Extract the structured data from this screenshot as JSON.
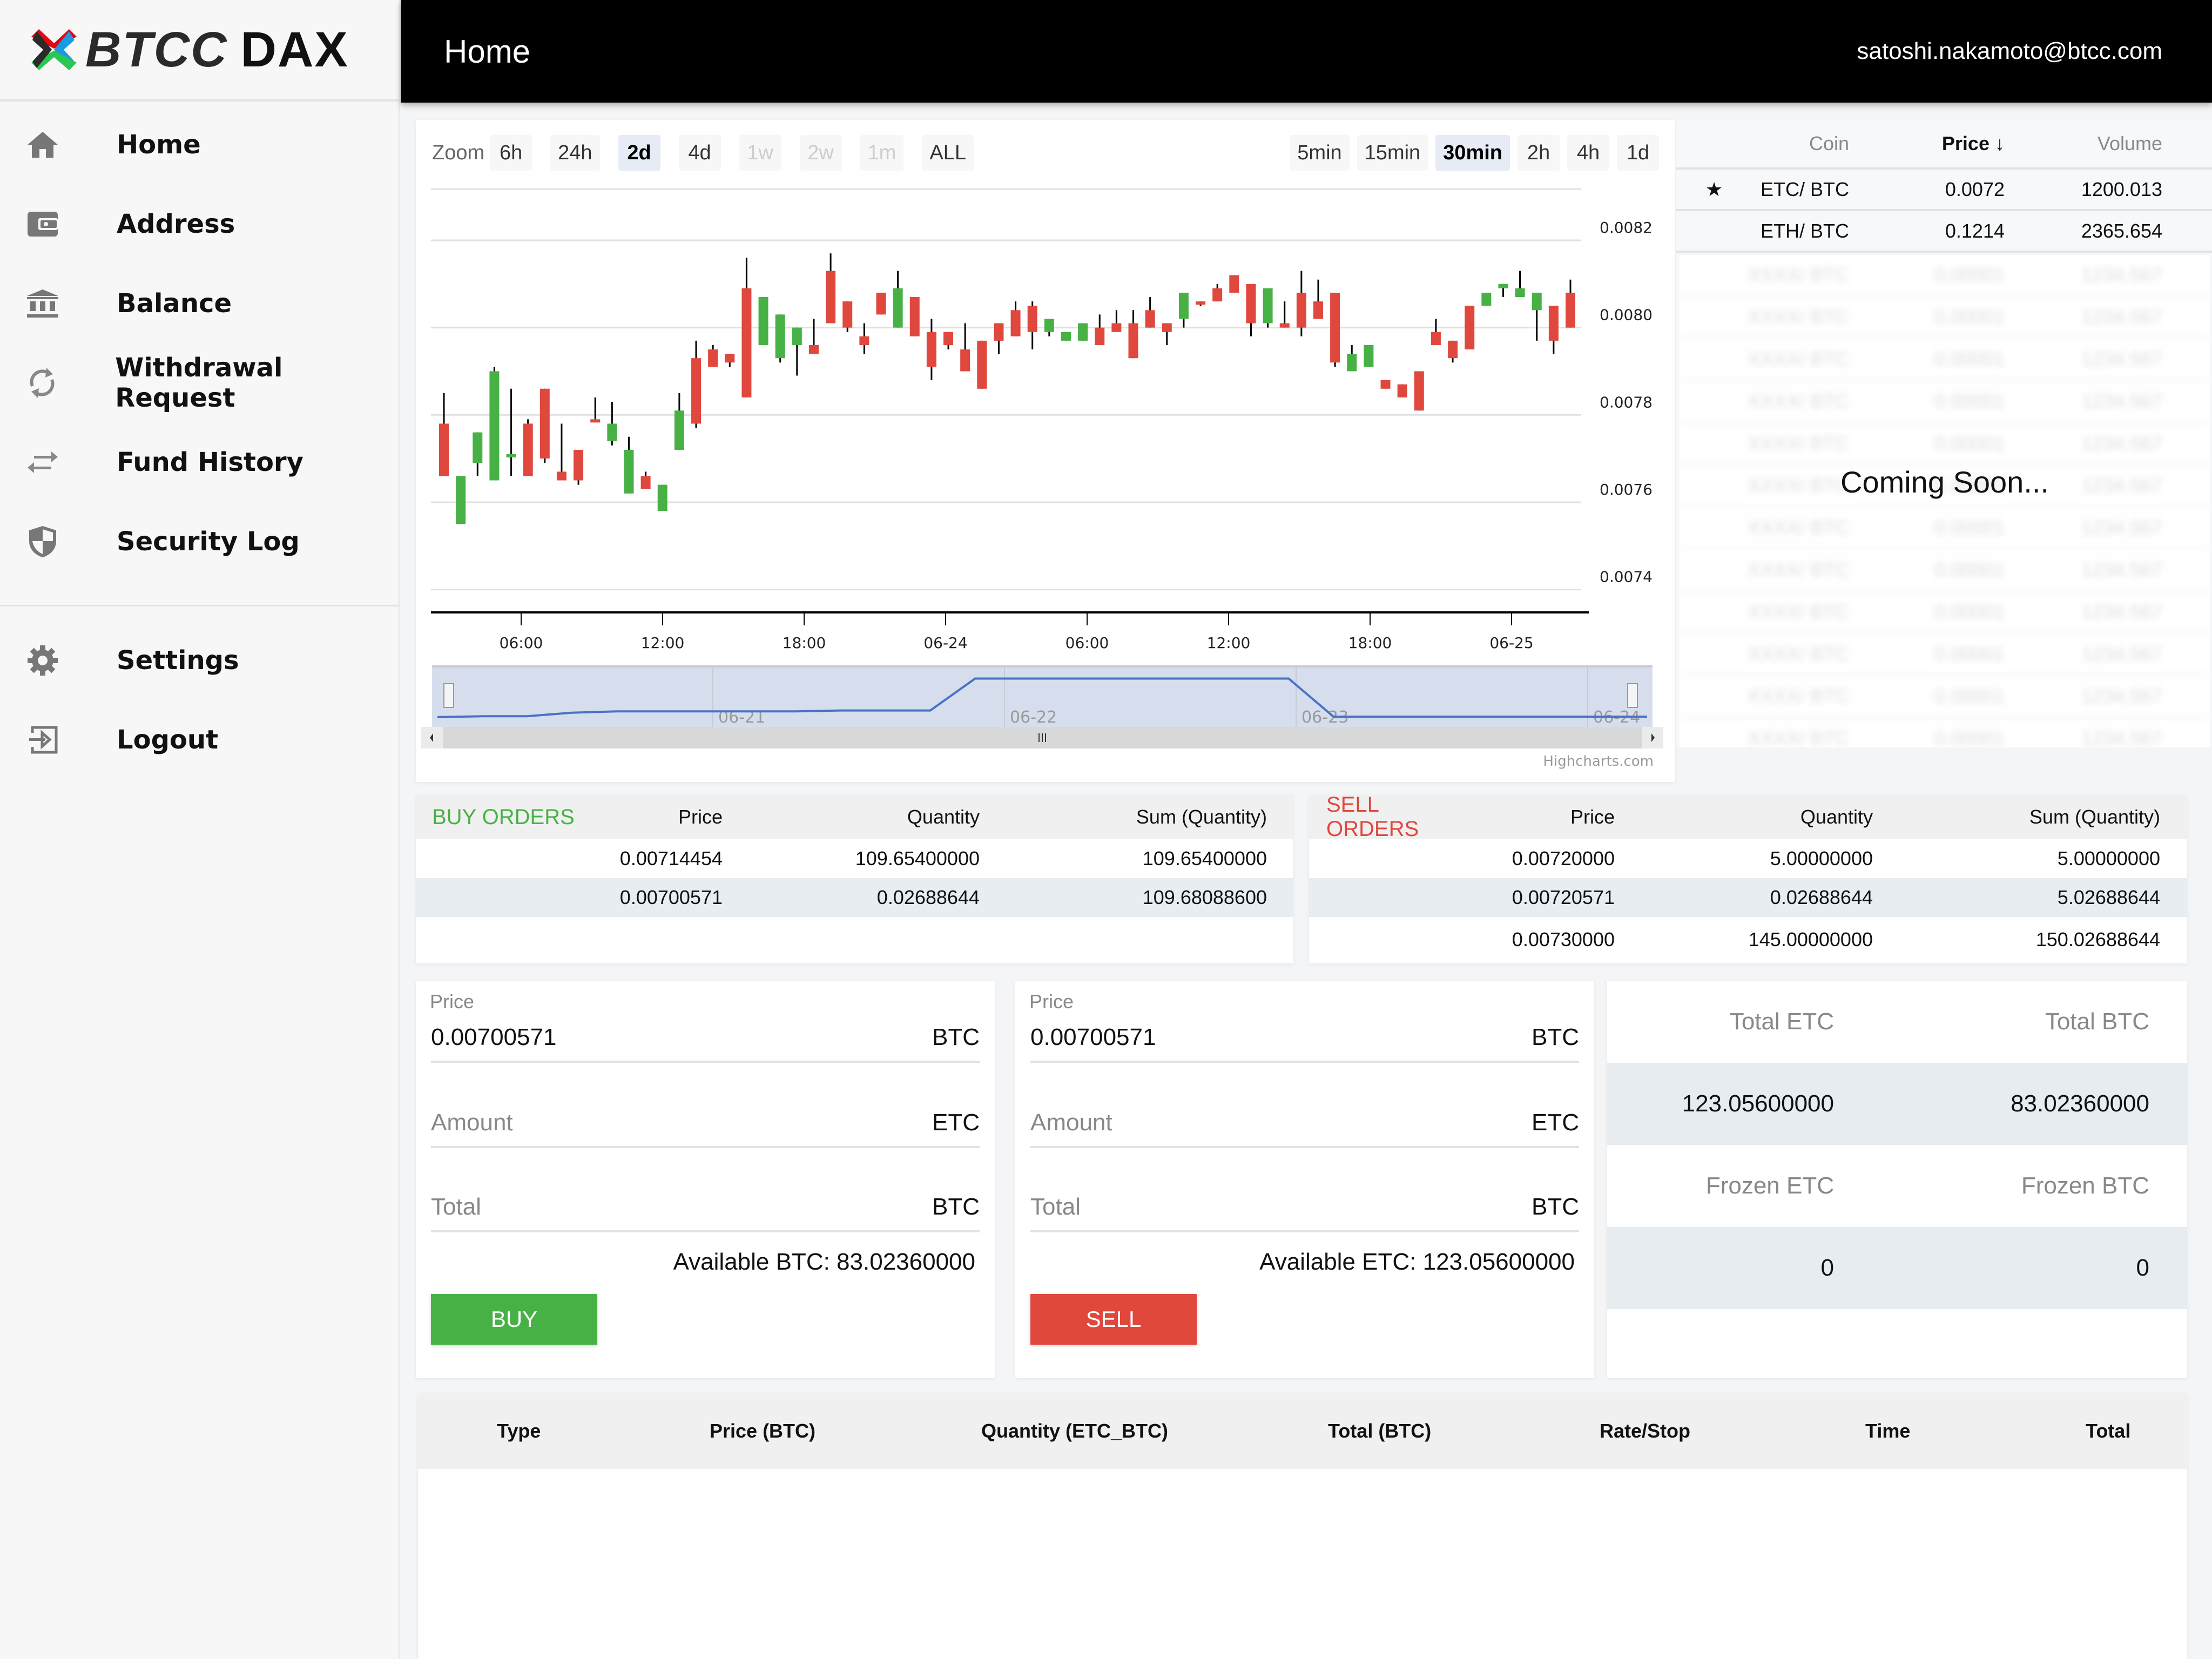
{
  "brand": {
    "name": "BTCC",
    "suffix": "DAX",
    "colors": {
      "red": "#e30613",
      "blue": "#1a9ae0",
      "green": "#2bc754",
      "dark": "#2c2a29"
    }
  },
  "header": {
    "title": "Home",
    "user_email": "satoshi.nakamoto@btcc.com"
  },
  "sidebar": {
    "items": [
      {
        "label": "Home",
        "icon": "home-icon"
      },
      {
        "label": "Address",
        "icon": "wallet-icon"
      },
      {
        "label": "Balance",
        "icon": "bank-icon"
      },
      {
        "label": "Withdrawal Request",
        "icon": "sync-icon"
      },
      {
        "label": "Fund History",
        "icon": "swap-arrows-icon"
      },
      {
        "label": "Security Log",
        "icon": "shield-icon"
      }
    ],
    "secondary": [
      {
        "label": "Settings",
        "icon": "gear-icon"
      },
      {
        "label": "Logout",
        "icon": "logout-icon"
      }
    ]
  },
  "chart_controls": {
    "zoom_label": "Zoom",
    "ranges": [
      {
        "label": "6h",
        "state": "enabled"
      },
      {
        "label": "24h",
        "state": "enabled"
      },
      {
        "label": "2d",
        "state": "selected"
      },
      {
        "label": "4d",
        "state": "enabled"
      },
      {
        "label": "1w",
        "state": "disabled"
      },
      {
        "label": "2w",
        "state": "disabled"
      },
      {
        "label": "1m",
        "state": "disabled"
      },
      {
        "label": "ALL",
        "state": "enabled"
      }
    ],
    "intervals": [
      {
        "label": "5min",
        "state": "enabled"
      },
      {
        "label": "15min",
        "state": "enabled"
      },
      {
        "label": "30min",
        "state": "selected"
      },
      {
        "label": "2h",
        "state": "enabled"
      },
      {
        "label": "4h",
        "state": "enabled"
      },
      {
        "label": "1d",
        "state": "enabled"
      }
    ],
    "credits": "Highcharts.com"
  },
  "chart_data": {
    "type": "candlestick",
    "title": "",
    "xlabel": "",
    "ylabel": "",
    "ylim": [
      0.00735,
      0.00832
    ],
    "y_ticks": [
      "0.0082",
      "0.0080",
      "0.0078",
      "0.0076",
      "0.0074"
    ],
    "x_ticks": [
      "06:00",
      "12:00",
      "18:00",
      "06-24",
      "06:00",
      "12:00",
      "18:00",
      "06-25"
    ],
    "up_color": "#47b145",
    "down_color": "#e0473d",
    "grid": true,
    "candles": [
      [
        0.00778,
        0.00766,
        0.00785,
        0.00766,
        "down"
      ],
      [
        0.00755,
        0.00766,
        0.00755,
        0.00766,
        "up"
      ],
      [
        0.00769,
        0.00776,
        0.00776,
        0.00766,
        "up"
      ],
      [
        0.00765,
        0.0079,
        0.00791,
        0.00765,
        "up"
      ],
      [
        0.00771,
        0.00771,
        0.00786,
        0.00766,
        "up"
      ],
      [
        0.00778,
        0.00766,
        0.00779,
        0.00766,
        "down"
      ],
      [
        0.00786,
        0.0077,
        0.00786,
        0.00769,
        "down"
      ],
      [
        0.00767,
        0.00765,
        0.00778,
        0.00765,
        "down"
      ],
      [
        0.00772,
        0.00765,
        0.00772,
        0.00764,
        "down"
      ],
      [
        0.00779,
        0.00779,
        0.00784,
        0.00779,
        "down"
      ],
      [
        0.00774,
        0.00778,
        0.00783,
        0.00773,
        "up"
      ],
      [
        0.00762,
        0.00772,
        0.00775,
        0.00762,
        "up"
      ],
      [
        0.00766,
        0.00763,
        0.00767,
        0.00763,
        "down"
      ],
      [
        0.00758,
        0.00764,
        0.00764,
        0.00758,
        "up"
      ],
      [
        0.00772,
        0.00781,
        0.00785,
        0.00772,
        "up"
      ],
      [
        0.00793,
        0.00778,
        0.00797,
        0.00777,
        "down"
      ],
      [
        0.00795,
        0.00791,
        0.00796,
        0.00791,
        "down"
      ],
      [
        0.00794,
        0.00792,
        0.00794,
        0.00791,
        "down"
      ],
      [
        0.00809,
        0.00784,
        0.00816,
        0.00784,
        "down"
      ],
      [
        0.00796,
        0.00807,
        0.00807,
        0.00796,
        "up"
      ],
      [
        0.00793,
        0.00803,
        0.00803,
        0.00792,
        "up"
      ],
      [
        0.00796,
        0.008,
        0.008,
        0.00789,
        "up"
      ],
      [
        0.00794,
        0.00796,
        0.00802,
        0.00794,
        "down"
      ],
      [
        0.00813,
        0.00801,
        0.00817,
        0.00801,
        "down"
      ],
      [
        0.00806,
        0.008,
        0.00806,
        0.00799,
        "down"
      ],
      [
        0.00796,
        0.00798,
        0.00801,
        0.00794,
        "down"
      ],
      [
        0.00808,
        0.00803,
        0.00808,
        0.00803,
        "down"
      ],
      [
        0.008,
        0.00809,
        0.00813,
        0.008,
        "up"
      ],
      [
        0.00807,
        0.00798,
        0.00807,
        0.00798,
        "down"
      ],
      [
        0.00791,
        0.00799,
        0.00802,
        0.00788,
        "down"
      ],
      [
        0.00799,
        0.00796,
        0.00799,
        0.00795,
        "down"
      ],
      [
        0.00795,
        0.0079,
        0.00801,
        0.0079,
        "down"
      ],
      [
        0.00797,
        0.00786,
        0.00797,
        0.00786,
        "down"
      ],
      [
        0.00797,
        0.00801,
        0.00801,
        0.00794,
        "down"
      ],
      [
        0.00804,
        0.00798,
        0.00806,
        0.00798,
        "down"
      ],
      [
        0.00805,
        0.00799,
        0.00806,
        0.00795,
        "down"
      ],
      [
        0.00799,
        0.00802,
        0.00802,
        0.00798,
        "up"
      ],
      [
        0.00797,
        0.00799,
        0.00799,
        0.00797,
        "up"
      ],
      [
        0.00797,
        0.00801,
        0.00801,
        0.00797,
        "up"
      ],
      [
        0.008,
        0.00796,
        0.00803,
        0.00796,
        "down"
      ],
      [
        0.00801,
        0.00799,
        0.00804,
        0.00799,
        "down"
      ],
      [
        0.00801,
        0.00793,
        0.00804,
        0.00793,
        "down"
      ],
      [
        0.00804,
        0.008,
        0.00807,
        0.008,
        "down"
      ],
      [
        0.00801,
        0.00799,
        0.00801,
        0.00796,
        "down"
      ],
      [
        0.00802,
        0.00808,
        0.00808,
        0.008,
        "up"
      ],
      [
        0.00806,
        0.00806,
        0.00806,
        0.00805,
        "down"
      ],
      [
        0.00809,
        0.00806,
        0.0081,
        0.00806,
        "down"
      ],
      [
        0.00812,
        0.00808,
        0.00812,
        0.00808,
        "down"
      ],
      [
        0.0081,
        0.00801,
        0.0081,
        0.00798,
        "down"
      ],
      [
        0.00801,
        0.00809,
        0.00809,
        0.008,
        "up"
      ],
      [
        0.00801,
        0.008,
        0.00806,
        0.008,
        "down"
      ],
      [
        0.00808,
        0.008,
        0.00813,
        0.00798,
        "down"
      ],
      [
        0.00806,
        0.00802,
        0.00811,
        0.00802,
        "down"
      ],
      [
        0.00808,
        0.00792,
        0.00808,
        0.00791,
        "down"
      ],
      [
        0.0079,
        0.00794,
        0.00796,
        0.0079,
        "up"
      ],
      [
        0.00791,
        0.00796,
        0.00796,
        0.00791,
        "up"
      ],
      [
        0.00788,
        0.00786,
        0.00788,
        0.00786,
        "down"
      ],
      [
        0.00787,
        0.00784,
        0.00787,
        0.00784,
        "down"
      ],
      [
        0.0079,
        0.00781,
        0.0079,
        0.00781,
        "down"
      ],
      [
        0.00799,
        0.00796,
        0.00802,
        0.00796,
        "down"
      ],
      [
        0.00797,
        0.00793,
        0.00797,
        0.00792,
        "down"
      ],
      [
        0.00805,
        0.00795,
        0.00805,
        0.00795,
        "down"
      ],
      [
        0.00805,
        0.00808,
        0.00808,
        0.00805,
        "up"
      ],
      [
        0.00809,
        0.0081,
        0.0081,
        0.00807,
        "up"
      ],
      [
        0.00809,
        0.00807,
        0.00813,
        0.00807,
        "up"
      ],
      [
        0.00804,
        0.00808,
        0.00808,
        0.00797,
        "up"
      ],
      [
        0.00805,
        0.00797,
        0.00805,
        0.00794,
        "down"
      ],
      [
        0.00808,
        0.008,
        0.00811,
        0.008,
        "down"
      ]
    ],
    "navigator": {
      "x_ticks": [
        "06-21",
        "06-22",
        "06-23",
        "06-24"
      ],
      "series": [
        0.05,
        0.07,
        0.07,
        0.15,
        0.18,
        0.18,
        0.18,
        0.18,
        0.18,
        0.2,
        0.2,
        0.2,
        0.92,
        0.92,
        0.92,
        0.92,
        0.92,
        0.92,
        0.92,
        0.92,
        0.06,
        0.06,
        0.06,
        0.06,
        0.06,
        0.06,
        0.06,
        0.06
      ]
    }
  },
  "markets": {
    "columns": {
      "coin": "Coin",
      "price": "Price",
      "volume": "Volume"
    },
    "sort_indicator": "↓",
    "rows": [
      {
        "favorite": true,
        "coin": "ETC/ BTC",
        "price": "0.0072",
        "volume": "1200.013"
      },
      {
        "favorite": false,
        "coin": "ETH/ BTC",
        "price": "0.1214",
        "volume": "2365.654"
      }
    ],
    "placeholder_rows": 12,
    "overlay_text": "Coming Soon..."
  },
  "buy_orders": {
    "title": "BUY ORDERS",
    "columns": [
      "Price",
      "Quantity",
      "Sum (Quantity)"
    ],
    "rows": [
      [
        "0.00714454",
        "109.65400000",
        "109.65400000"
      ],
      [
        "0.00700571",
        "0.02688644",
        "109.68088600"
      ]
    ]
  },
  "sell_orders": {
    "title": "SELL ORDERS",
    "columns": [
      "Price",
      "Quantity",
      "Sum (Quantity)"
    ],
    "rows": [
      [
        "0.00720000",
        "5.00000000",
        "5.00000000"
      ],
      [
        "0.00720571",
        "0.02688644",
        "5.02688644"
      ],
      [
        "0.00730000",
        "145.00000000",
        "150.02688644"
      ]
    ]
  },
  "buy_form": {
    "price_label": "Price",
    "price_value": "0.00700571",
    "price_unit": "BTC",
    "amount_placeholder": "Amount",
    "amount_unit": "ETC",
    "total_placeholder": "Total",
    "total_unit": "BTC",
    "available": "Available BTC: 83.02360000",
    "button": "BUY",
    "button_color": "#47b145"
  },
  "sell_form": {
    "price_label": "Price",
    "price_value": "0.00700571",
    "price_unit": "BTC",
    "amount_placeholder": "Amount",
    "amount_unit": "ETC",
    "total_placeholder": "Total",
    "total_unit": "BTC",
    "available": "Available ETC: 123.05600000",
    "button": "SELL",
    "button_color": "#e0473d"
  },
  "balances": {
    "total_etc_label": "Total ETC",
    "total_btc_label": "Total BTC",
    "total_etc": "123.05600000",
    "total_btc": "83.02360000",
    "frozen_etc_label": "Frozen ETC",
    "frozen_btc_label": "Frozen BTC",
    "frozen_etc": "0",
    "frozen_btc": "0"
  },
  "order_history": {
    "columns": [
      "Type",
      "Price (BTC)",
      "Quantity (ETC_BTC)",
      "Total (BTC)",
      "Rate/Stop",
      "Time",
      "Total"
    ]
  }
}
